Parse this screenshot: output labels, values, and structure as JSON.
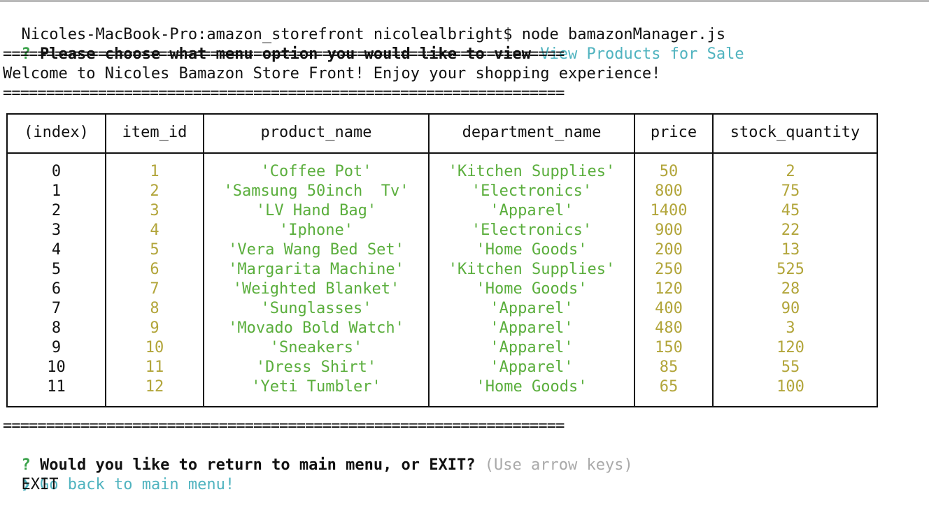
{
  "terminal": {
    "command_line": "Nicoles-MacBook-Pro:amazon_storefront nicolealbright$ node bamazonManager.js",
    "prompt1": {
      "mark": "?",
      "question": "Please choose what menu option you would like to view",
      "answer": "View Products for Sale"
    },
    "rule": "=================================================================",
    "welcome": "Welcome to Nicoles Bamazon Store Front! Enjoy your shopping experience!",
    "prompt2": {
      "mark": "?",
      "question": "Would you like to return to main menu, or EXIT?",
      "hint": "(Use arrow keys)"
    },
    "choices": {
      "pointer": "❯",
      "selected": "Go back to main menu!",
      "other": "EXIT"
    }
  },
  "table": {
    "headers": [
      "(index)",
      "item_id",
      "product_name",
      "department_name",
      "price",
      "stock_quantity"
    ],
    "rows": [
      [
        "0",
        "1",
        "'Coffee Pot'",
        "'Kitchen Supplies'",
        "50",
        "2"
      ],
      [
        "1",
        "2",
        "'Samsung 50inch  Tv'",
        "'Electronics'",
        "800",
        "75"
      ],
      [
        "2",
        "3",
        "'LV Hand Bag'",
        "'Apparel'",
        "1400",
        "45"
      ],
      [
        "3",
        "4",
        "'Iphone'",
        "'Electronics'",
        "900",
        "22"
      ],
      [
        "4",
        "5",
        "'Vera Wang Bed Set'",
        "'Home Goods'",
        "200",
        "13"
      ],
      [
        "5",
        "6",
        "'Margarita Machine'",
        "'Kitchen Supplies'",
        "250",
        "525"
      ],
      [
        "6",
        "7",
        "'Weighted Blanket'",
        "'Home Goods'",
        "120",
        "28"
      ],
      [
        "7",
        "8",
        "'Sunglasses'",
        "'Apparel'",
        "400",
        "90"
      ],
      [
        "8",
        "9",
        "'Movado Bold Watch'",
        "'Apparel'",
        "480",
        "3"
      ],
      [
        "9",
        "10",
        "'Sneakers'",
        "'Apparel'",
        "150",
        "120"
      ],
      [
        "10",
        "11",
        "'Dress Shirt'",
        "'Apparel'",
        "85",
        "55"
      ],
      [
        "11",
        "12",
        "'Yeti Tumbler'",
        "'Home Goods'",
        "65",
        "100"
      ]
    ]
  },
  "colors": {
    "prompt_mark": "#3aa24a",
    "answer": "#4fb3bf",
    "string_value": "#5aae3c",
    "number_value": "#b2a53a",
    "hint": "#a9a9a9"
  }
}
